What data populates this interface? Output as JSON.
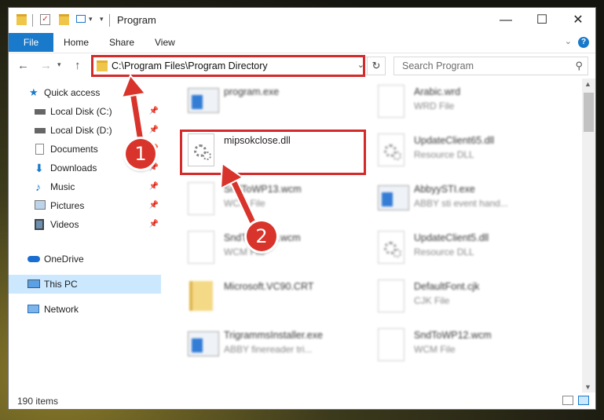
{
  "window": {
    "title": "Program"
  },
  "ribbon": {
    "file": "File",
    "home": "Home",
    "share": "Share",
    "view": "View",
    "help": "?"
  },
  "address": {
    "path": "C:\\Program Files\\Program Directory"
  },
  "search": {
    "placeholder": "Search Program"
  },
  "sidebar": {
    "items": [
      {
        "label": "Quick access",
        "icon": "star-icon"
      },
      {
        "label": "Local Disk (C:)",
        "icon": "drive-icon"
      },
      {
        "label": "Local Disk (D:)",
        "icon": "drive-icon"
      },
      {
        "label": "Documents",
        "icon": "documents-icon"
      },
      {
        "label": "Downloads",
        "icon": "download-icon"
      },
      {
        "label": "Music",
        "icon": "music-icon"
      },
      {
        "label": "Pictures",
        "icon": "pictures-icon"
      },
      {
        "label": "Videos",
        "icon": "videos-icon"
      },
      {
        "label": "OneDrive",
        "icon": "cloud-icon"
      },
      {
        "label": "This PC",
        "icon": "computer-icon"
      },
      {
        "label": "Network",
        "icon": "network-icon"
      }
    ]
  },
  "files": [
    {
      "name": "program.exe",
      "type": ""
    },
    {
      "name": "Arabic.wrd",
      "type": "WRD File"
    },
    {
      "name": "mipsokclose.dll",
      "type": ""
    },
    {
      "name": "UpdateClient65.dll",
      "type": "Resource DLL"
    },
    {
      "name": "SndToWP13.wcm",
      "type": "WCM File"
    },
    {
      "name": "AbbyySTI.exe",
      "type": "ABBY sti event hand..."
    },
    {
      "name": "SndToWP11.wcm",
      "type": "WCM File"
    },
    {
      "name": "UpdateClient5.dll",
      "type": "Resource DLL"
    },
    {
      "name": "Microsoft.VC90.CRT",
      "type": ""
    },
    {
      "name": "DefaultFont.cjk",
      "type": "CJK File"
    },
    {
      "name": "TrigrammsInstaller.exe",
      "type": "ABBY finereader tri..."
    },
    {
      "name": "SndToWP12.wcm",
      "type": "WCM File"
    }
  ],
  "status": {
    "count": "190 items"
  },
  "callouts": {
    "one": "1",
    "two": "2"
  }
}
